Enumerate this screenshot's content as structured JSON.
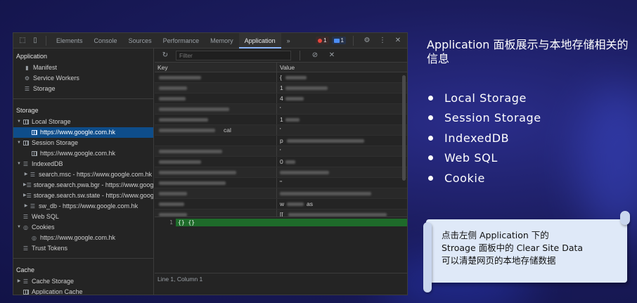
{
  "devtools": {
    "tabs": [
      "Elements",
      "Console",
      "Sources",
      "Performance",
      "Memory",
      "Application"
    ],
    "active_tab": "Application",
    "more_tabs": "»",
    "error_count": "1",
    "message_count": "1",
    "sidebar": {
      "application_header": "Application",
      "application_items": [
        "Manifest",
        "Service Workers",
        "Storage"
      ],
      "storage_header": "Storage",
      "local_storage": "Local Storage",
      "local_storage_origin": "https://www.google.com.hk",
      "session_storage": "Session Storage",
      "session_storage_origin": "https://www.google.com.hk",
      "indexeddb": "IndexedDB",
      "indexeddb_items": [
        "search.msc - https://www.google.com.hk",
        "storage.search.pwa.bgr - https://www.google.com.hk",
        "storage.search.sw.state - https://www.google.com.hk",
        "sw_db - https://www.google.com.hk"
      ],
      "web_sql": "Web SQL",
      "cookies": "Cookies",
      "cookies_origin": "https://www.google.com.hk",
      "trust_tokens": "Trust Tokens",
      "cache_header": "Cache",
      "cache_storage": "Cache Storage",
      "application_cache": "Application Cache"
    },
    "filter_placeholder": "Filter",
    "columns": {
      "key": "Key",
      "value": "Value"
    },
    "row_values": [
      "{",
      "1",
      "4",
      "'",
      "1",
      "'",
      "p",
      "'",
      "0",
      "",
      "\"",
      "",
      "w",
      "[["
    ],
    "row_key_fragments": {
      "row5": "cal"
    },
    "row_value_fragments": {
      "row12": "as"
    },
    "editor": {
      "line_number": "1",
      "code": "{}  {}"
    },
    "status": "Line 1, Column 1"
  },
  "slide": {
    "title": "Application 面板展示与本地存储相关的信息",
    "bullets": [
      "Local Storage",
      "Session Storage",
      "IndexedDB",
      "Web SQL",
      "Cookie"
    ],
    "note_lines": [
      "点击左侧 Application 下的",
      "Stroage 面板中的 Clear Site Data",
      "可以清楚网页的本地存储数据"
    ]
  },
  "colors": {
    "background": "#1b1c5e",
    "selection": "#0e4d8a",
    "editor_highlight": "#1e6b2a",
    "note": "#dfe9f8"
  }
}
